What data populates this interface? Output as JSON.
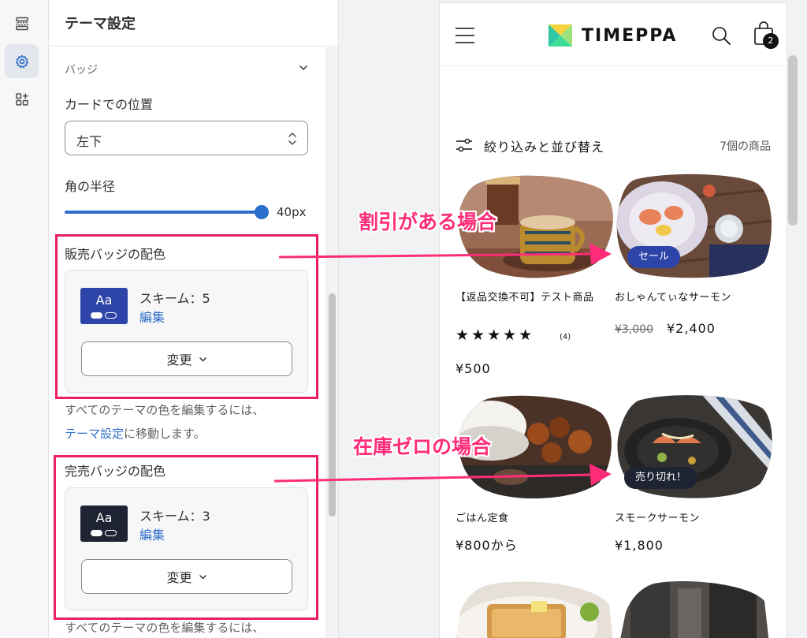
{
  "rail": {
    "items": [
      {
        "icon": "sections-icon",
        "active": false
      },
      {
        "icon": "gear-icon",
        "active": true
      },
      {
        "icon": "apps-icon",
        "active": false
      }
    ]
  },
  "panel": {
    "title": "テーマ設定",
    "section": "バッジ",
    "position_label": "カードでの位置",
    "position_value": "左下",
    "radius_label": "角の半径",
    "radius_value": "40px",
    "radius_fraction": 1.0,
    "sale_badge": {
      "label": "販売バッジの配色",
      "scheme": "スキーム：5",
      "edit": "編集",
      "change": "変更",
      "color": "#2d44a8"
    },
    "soldout_badge": {
      "label": "完売バッジの配色",
      "scheme": "スキーム：3",
      "edit": "編集",
      "change": "変更",
      "color": "#1e2433"
    },
    "help_prefix": "すべてのテーマの色を編集するには、",
    "help_link": "テーマ設定",
    "help_suffix": "に移動します。",
    "help_prefix_2": "すべてのテーマの色を編集するには、"
  },
  "preview": {
    "brand": "TIMEPPA",
    "cart_count": "2",
    "filter_label": "絞り込みと並び替え",
    "product_count": "7個の商品",
    "products": [
      {
        "name": "【返品交換不可】テスト商品",
        "stars": "★★★★★",
        "rating_count": "(4)",
        "price": "¥500"
      },
      {
        "name": "おしゃんてぃなサーモン",
        "badge": "セール",
        "old_price": "¥3,000",
        "price": "¥2,400"
      },
      {
        "name": "ごはん定食",
        "price": "¥800から"
      },
      {
        "name": "スモークサーモン",
        "badge": "売り切れ！",
        "price": "¥1,800"
      }
    ]
  },
  "annotations": {
    "discount": "割引がある場合",
    "soldout": "在庫ゼロの場合",
    "color": "#ff2d79"
  }
}
